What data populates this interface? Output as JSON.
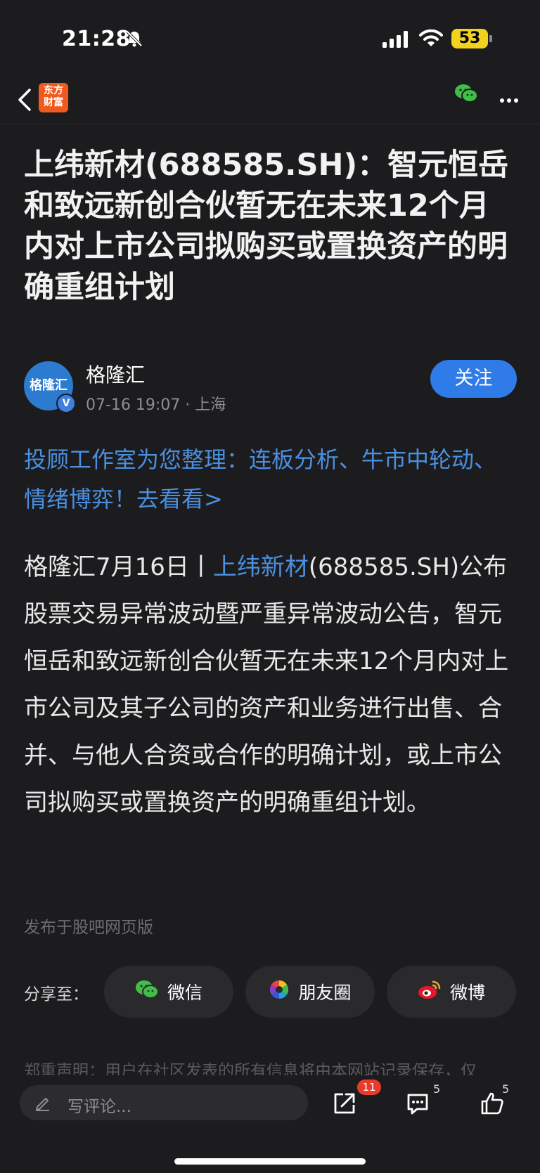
{
  "status_bar": {
    "time": "21:28",
    "battery": "53",
    "icons": [
      "bell-slash-icon",
      "cellular-signal-icon",
      "wifi-icon",
      "battery-icon"
    ]
  },
  "nav": {
    "back_icon": "chevron-left-icon",
    "logo_line1": "东方",
    "logo_line2": "财富",
    "wechat_icon": "wechat-icon",
    "more_icon": "more-dots-icon"
  },
  "article": {
    "title": "上纬新材(688585.SH)：智元恒岳和致远新创合伙暂无在未来12个月内对上市公司拟购买或置换资产的明确重组计划",
    "author": {
      "avatar_text": "格隆汇",
      "verified_mark": "V",
      "name": "格隆汇",
      "meta": "07-16 19:07 · 上海",
      "follow_label": "关注"
    },
    "promo": "投顾工作室为您整理：连板分析、牛市中轮动、情绪博弈！去看看>",
    "body_prefix": "格隆汇7月16日丨",
    "body_link": "上纬新材",
    "body_rest": "(688585.SH)公布股票交易异常波动暨严重异常波动公告，智元恒岳和致远新创合伙暂无在未来12个月内对上市公司及其子公司的资产和业务进行出售、合并、与他人合资或合作的明确计划，或上市公司拟购买或置换资产的明确重组计划。",
    "source": "发布于股吧网页版"
  },
  "share": {
    "label": "分享至：",
    "wechat": "微信",
    "moments": "朋友圈",
    "weibo": "微博"
  },
  "disclaimer": "郑重声明：用户在社区发表的所有信息将由本网站记录保存，仅",
  "bottom_bar": {
    "comment_placeholder": "写评论...",
    "share_count": "11",
    "comment_count": "5",
    "like_count": "5"
  },
  "colors": {
    "background": "#1c1c1e",
    "link_blue": "#4a8fe0",
    "follow_blue": "#2f7be8",
    "badge_red": "#e83b2e",
    "battery_yellow": "#f2d21d",
    "logo_orange": "#ef5a1e"
  }
}
